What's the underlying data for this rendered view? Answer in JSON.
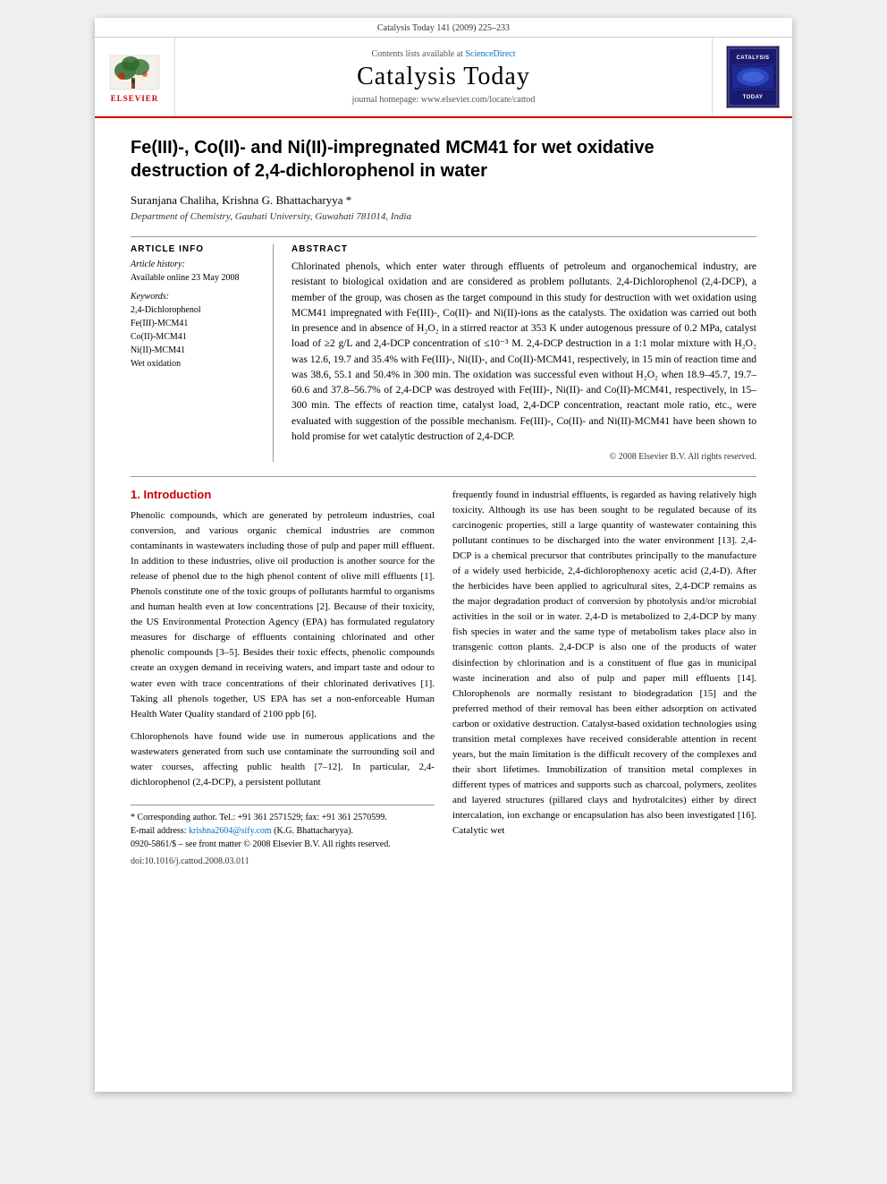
{
  "page_header": {
    "text": "Catalysis Today 141 (2009) 225–233"
  },
  "journal_header": {
    "sciencedirect_prefix": "Contents lists available at ",
    "sciencedirect_link": "ScienceDirect",
    "journal_title": "Catalysis Today",
    "homepage_prefix": "journal homepage: ",
    "homepage_url": "www.elsevier.com/locate/cattod",
    "elsevier_label": "ELSEVIER",
    "badge_lines": [
      "CATALYSIS",
      "TODAY"
    ]
  },
  "article": {
    "title": "Fe(III)-, Co(II)- and Ni(II)-impregnated MCM41 for wet oxidative destruction of 2,4-dichlorophenol in water",
    "authors": "Suranjana Chaliha, Krishna G. Bhattacharyya *",
    "affiliation": "Department of Chemistry, Gauhati University, Guwahati 781014, India",
    "article_info": {
      "section_label": "ARTICLE INFO",
      "history_label": "Article history:",
      "available_online": "Available online 23 May 2008",
      "keywords_label": "Keywords:",
      "keywords": [
        "2,4-Dichlorophenol",
        "Fe(III)-MCM41",
        "Co(II)-MCM41",
        "Ni(II)-MCM41",
        "Wet oxidation"
      ]
    },
    "abstract": {
      "section_label": "ABSTRACT",
      "text": "Chlorinated phenols, which enter water through effluents of petroleum and organochemical industry, are resistant to biological oxidation and are considered as problem pollutants. 2,4-Dichlorophenol (2,4-DCP), a member of the group, was chosen as the target compound in this study for destruction with wet oxidation using MCM41 impregnated with Fe(III)-, Co(II)- and Ni(II)-ions as the catalysts. The oxidation was carried out both in presence and in absence of H₂O₂ in a stirred reactor at 353 K under autogenous pressure of 0.2 MPa, catalyst load of ≥2 g/L and 2,4-DCP concentration of ≤10⁻³ M. 2,4-DCP destruction in a 1:1 molar mixture with H₂O₂ was 12.6, 19.7 and 35.4% with Fe(III)-, Ni(II)-, and Co(II)-MCM41, respectively, in 15 min of reaction time and was 38.6, 55.1 and 50.4% in 300 min. The oxidation was successful even without H₂O₂ when 18.9–45.7, 19.7–60.6 and 37.8–56.7% of 2,4-DCP was destroyed with Fe(III)-, Ni(II)- and Co(II)-MCM41, respectively, in 15–300 min. The effects of reaction time, catalyst load, 2,4-DCP concentration, reactant mole ratio, etc., were evaluated with suggestion of the possible mechanism. Fe(III)-, Co(II)- and Ni(II)-MCM41 have been shown to hold promise for wet catalytic destruction of 2,4-DCP.",
      "copyright": "© 2008 Elsevier B.V. All rights reserved."
    },
    "introduction": {
      "heading": "1. Introduction",
      "paragraphs": [
        "Phenolic compounds, which are generated by petroleum industries, coal conversion, and various organic chemical industries are common contaminants in wastewaters including those of pulp and paper mill effluent. In addition to these industries, olive oil production is another source for the release of phenol due to the high phenol content of olive mill effluents [1]. Phenols constitute one of the toxic groups of pollutants harmful to organisms and human health even at low concentrations [2]. Because of their toxicity, the US Environmental Protection Agency (EPA) has formulated regulatory measures for discharge of effluents containing chlorinated and other phenolic compounds [3–5]. Besides their toxic effects, phenolic compounds create an oxygen demand in receiving waters, and impart taste and odour to water even with trace concentrations of their chlorinated derivatives [1]. Taking all phenols together, US EPA has set a non-enforceable Human Health Water Quality standard of 2100 ppb [6].",
        "Chlorophenols have found wide use in numerous applications and the wastewaters generated from such use contaminate the surrounding soil and water courses, affecting public health [7–12]. In particular, 2,4-dichlorophenol (2,4-DCP), a persistent pollutant"
      ]
    },
    "right_column": {
      "paragraphs": [
        "frequently found in industrial effluents, is regarded as having relatively high toxicity. Although its use has been sought to be regulated because of its carcinogenic properties, still a large quantity of wastewater containing this pollutant continues to be discharged into the water environment [13]. 2,4-DCP is a chemical precursor that contributes principally to the manufacture of a widely used herbicide, 2,4-dichlorophenoxy acetic acid (2,4-D). After the herbicides have been applied to agricultural sites, 2,4-DCP remains as the major degradation product of conversion by photolysis and/or microbial activities in the soil or in water. 2,4-D is metabolized to 2,4-DCP by many fish species in water and the same type of metabolism takes place also in transgenic cotton plants. 2,4-DCP is also one of the products of water disinfection by chlorination and is a constituent of flue gas in municipal waste incineration and also of pulp and paper mill effluents [14]. Chlorophenols are normally resistant to biodegradation [15] and the preferred method of their removal has been either adsorption on activated carbon or oxidative destruction. Catalyst-based oxidation technologies using transition metal complexes have received considerable attention in recent years, but the main limitation is the difficult recovery of the complexes and their short lifetimes. Immobilization of transition metal complexes in different types of matrices and supports such as charcoal, polymers, zeolites and layered structures (pillared clays and hydrotalcites) either by direct intercalation, ion exchange or encapsulation has also been investigated [16]. Catalytic wet"
      ]
    },
    "footnotes": {
      "corresponding_author": "* Corresponding author. Tel.: +91 361 2571529; fax: +91 361 2570599.",
      "email_prefix": "E-mail address: ",
      "email": "krishna2604@sify.com",
      "email_suffix": " (K.G. Bhattacharyya).",
      "issn_line": "0920-5861/$ – see front matter © 2008 Elsevier B.V. All rights reserved.",
      "doi_line": "doi:10.1016/j.cattod.2008.03.011"
    }
  }
}
